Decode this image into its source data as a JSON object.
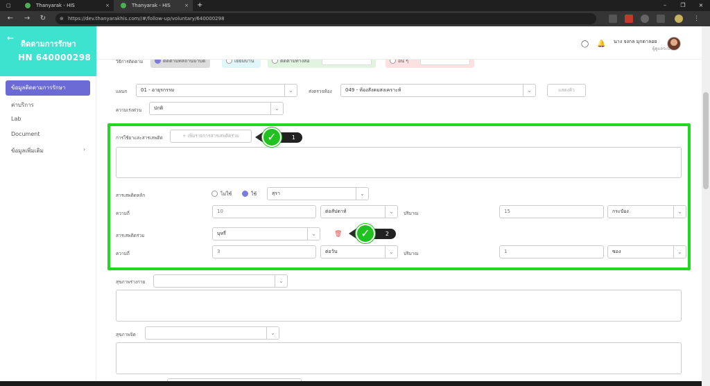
{
  "browser": {
    "tabs": [
      {
        "label": "Thanyarak - HIS"
      },
      {
        "label": "Thanyarak - HIS"
      }
    ],
    "new_tab": "+",
    "close": "×",
    "url": "https://dev.thanyarakhis.com//#/follow-up/voluntary/640000298",
    "window_controls": [
      "–",
      "❐",
      "×"
    ]
  },
  "sidebar": {
    "title": "ติดตามการรักษา",
    "hn": "HN 640000298",
    "items": [
      {
        "label": "ข้อมูลติดตามการรักษา",
        "active": true
      },
      {
        "label": "ค่าบริการ"
      },
      {
        "label": "Lab"
      },
      {
        "label": "Document"
      },
      {
        "label": "ข้อมูลเพิ่มเติม"
      }
    ],
    "more_chevron": "›"
  },
  "header": {
    "user_name": "นาง จงกล มุกดาลอย",
    "user_role": "ผู้ดูแลระบบ"
  },
  "form": {
    "method_label": "วิธีการติดตาม",
    "methods": [
      {
        "label": "ติดตามที่สถานบำบัด",
        "selected": true
      },
      {
        "label": "เยี่ยมบ้าน"
      },
      {
        "label": "ติดตามทางสื่อ"
      },
      {
        "label": "อื่น ๆ"
      }
    ],
    "dept_label": "แผนก",
    "dept_value": "01 - อายุรกรรม",
    "refer_label": "ส่งตรวจห้อง",
    "refer_value": "049 - ห้องสังคมสงเคราะห์",
    "show_queue_button": "แสดงคิว",
    "urgency_label": "ความเร่งด่วน",
    "urgency_value": "ปกติ",
    "substance_use_label": "การใช้ยาและสารเสพติด",
    "add_substance_button": "+ เพิ่มรายการสารเสพติดร่วม",
    "main_substance_label": "สารเสพติดหลัก",
    "radio_no": "ไม่ใช้",
    "radio_yes": "ใช้",
    "main_substance_value": "สุรา",
    "freq_label": "ความถี่",
    "main_freq_value": "10",
    "main_freq_unit": "ต่อสัปดาห์",
    "amount_label": "ปริมาณ",
    "main_amount_value": "15",
    "main_amount_unit": "กระป๋อง",
    "co_substance_label": "สารเสพติดร่วม",
    "co_substance_value": "บุหรี่",
    "co_freq_value": "3",
    "co_freq_unit": "ต่อวัน",
    "co_amount_value": "1",
    "co_amount_unit": "ซอง",
    "physical_label": "สุขภาพร่างกาย",
    "mental_label": "สุขภาพจิต"
  },
  "callouts": [
    {
      "number": "1",
      "check": "✓"
    },
    {
      "number": "2",
      "check": "✓"
    }
  ],
  "colors": {
    "sidebar_header": "#3ee3cf",
    "accent": "#6c6bd6",
    "highlight": "#1fd81f"
  }
}
